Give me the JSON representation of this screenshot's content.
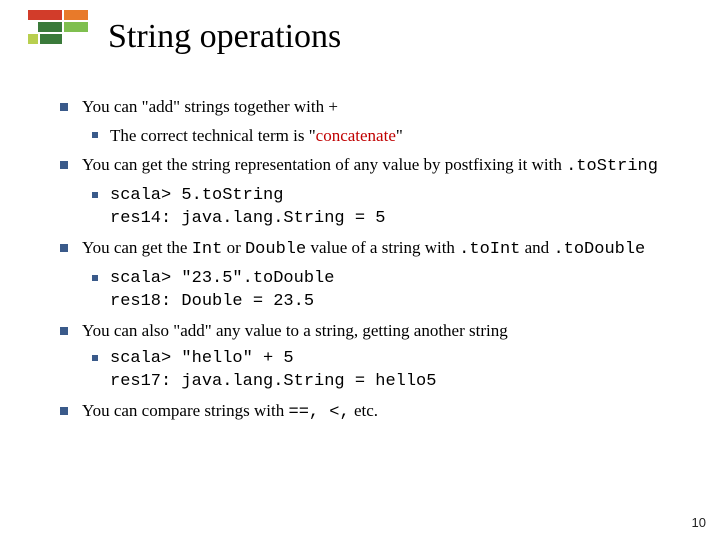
{
  "page_number": "10",
  "title": "String operations",
  "bullets": {
    "add_strings": "You can \"add\" strings together with  +",
    "tech_term_pre": "The correct technical term is \"",
    "tech_term_hl": "concatenate",
    "tech_term_post": "\"",
    "to_string_pre": "You can get the string representation of any value by postfixing it with ",
    "to_string_code": ".toString",
    "repl1_line1": "scala> 5.toString",
    "repl1_line2": "res14: java.lang.String = 5",
    "int_dbl_pre": "You can get the ",
    "int_dbl_int": "Int",
    "int_dbl_mid1": " or ",
    "int_dbl_double": "Double",
    "int_dbl_mid2": " value of a string with ",
    "int_dbl_toint": " .toInt",
    "int_dbl_and": " and ",
    "int_dbl_todouble": ".toDouble",
    "repl2_line1": "scala> \"23.5\".toDouble",
    "repl2_line2": "res18: Double = 23.5",
    "add_any": "You can also \"add\" any value to a string, getting another string",
    "repl3_line1": "scala> \"hello\" + 5",
    "repl3_line2": "res17: java.lang.String = hello5",
    "compare_pre": "You can compare strings with ",
    "compare_code": "==, <,",
    "compare_post": " etc."
  }
}
